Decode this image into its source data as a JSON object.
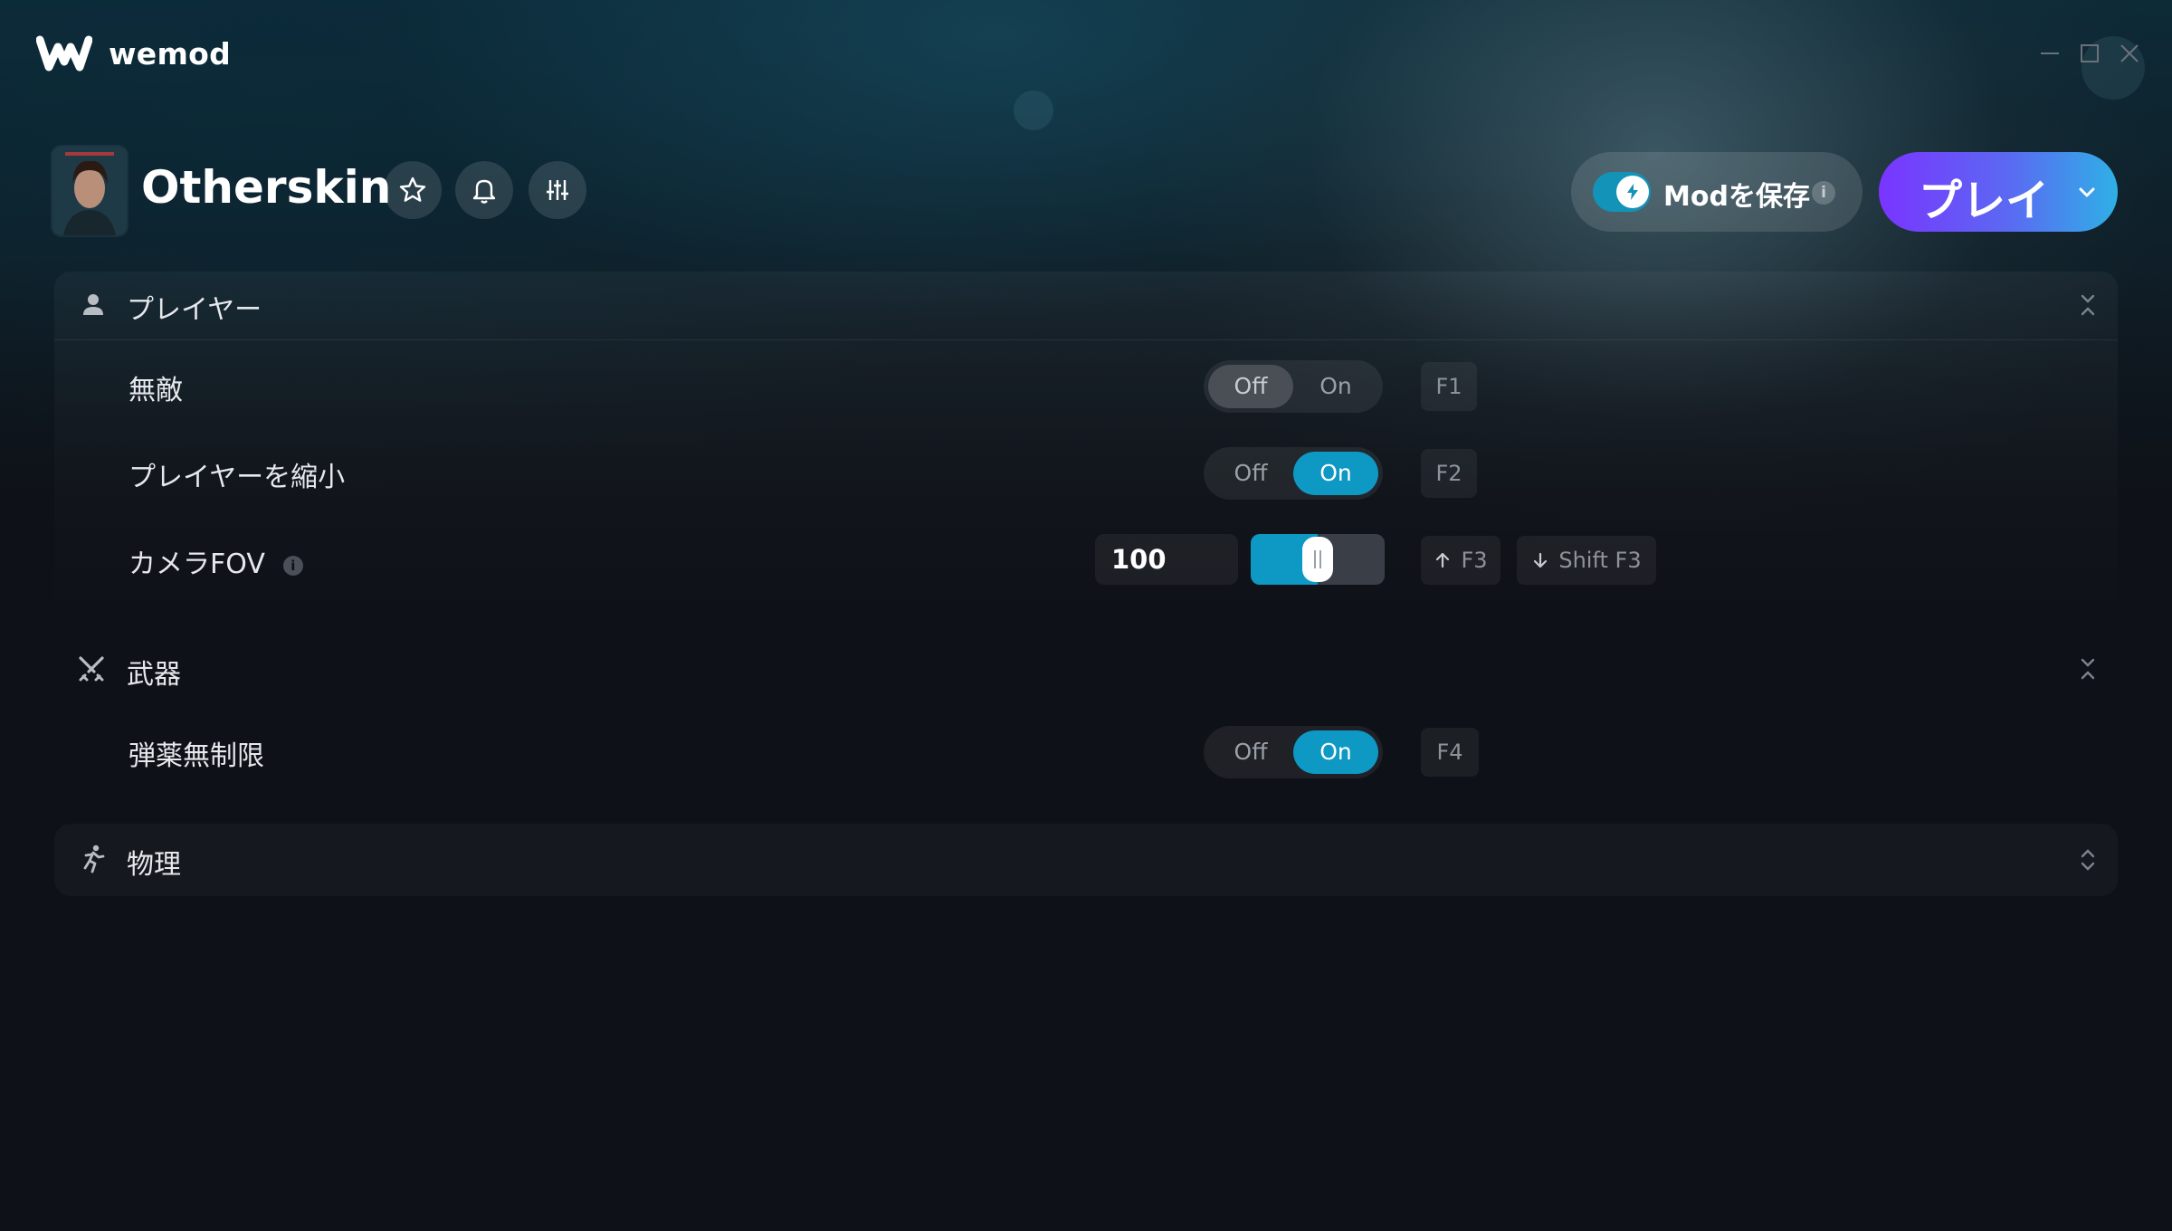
{
  "app": {
    "brand": "wemod"
  },
  "game": {
    "title": "Otherskin"
  },
  "header": {
    "save_mods_label": "Modを保存",
    "save_mods_enabled": true,
    "save_info": "i",
    "play_label": "プレイ"
  },
  "sections": [
    {
      "title": "プレイヤー",
      "icon": "person-icon",
      "expanded": true,
      "mods": [
        {
          "label": "無敵",
          "type": "toggle",
          "off_label": "Off",
          "on_label": "On",
          "state": "Off",
          "hotkey": "F1"
        },
        {
          "label": "プレイヤーを縮小",
          "type": "toggle",
          "off_label": "Off",
          "on_label": "On",
          "state": "On",
          "hotkey": "F2"
        },
        {
          "label": "カメラFOV",
          "type": "slider",
          "value": "100",
          "fill": 0.5,
          "inc_hotkey": "F3",
          "dec_hotkey": "Shift F3"
        }
      ]
    },
    {
      "title": "武器",
      "icon": "crossed-swords-icon",
      "expanded": true,
      "mods": [
        {
          "label": "弾薬無制限",
          "type": "toggle",
          "off_label": "Off",
          "on_label": "On",
          "state": "On",
          "hotkey": "F4"
        }
      ]
    },
    {
      "title": "物理",
      "icon": "running-figure-icon",
      "expanded": false,
      "mods": []
    }
  ],
  "colors": {
    "accent": "#0e98c4",
    "play_gradient_start": "#7a34ff",
    "play_gradient_end": "#2fb0e6",
    "background": "#0e1117"
  }
}
